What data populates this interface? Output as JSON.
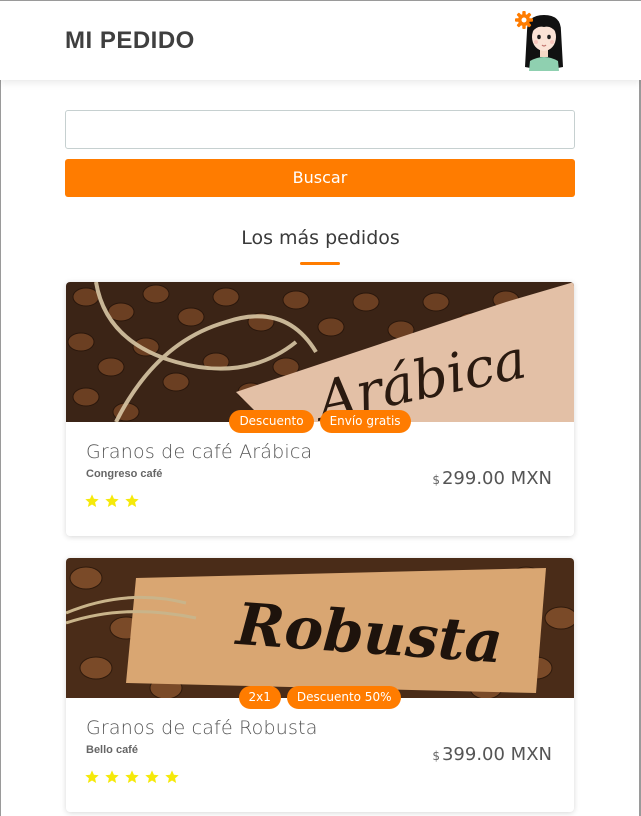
{
  "header": {
    "title": "MI PEDIDO"
  },
  "search": {
    "value": "",
    "placeholder": "",
    "button_label": "Buscar"
  },
  "section": {
    "title": "Los más pedidos"
  },
  "colors": {
    "accent": "#ff7c00",
    "star": "#f5e90a"
  },
  "products": [
    {
      "name": "Granos de café Arábica",
      "brand": "Congreso café",
      "currency_symbol": "$",
      "price": "299.00 MXN",
      "badges": [
        "Descuento",
        "Envío gratis"
      ],
      "rating": 3,
      "image_tag_text": "Arábica"
    },
    {
      "name": "Granos de café Robusta",
      "brand": "Bello café",
      "currency_symbol": "$",
      "price": "399.00 MXN",
      "badges": [
        "2x1",
        "Descuento 50%"
      ],
      "rating": 5,
      "image_tag_text": "Robusta"
    }
  ]
}
